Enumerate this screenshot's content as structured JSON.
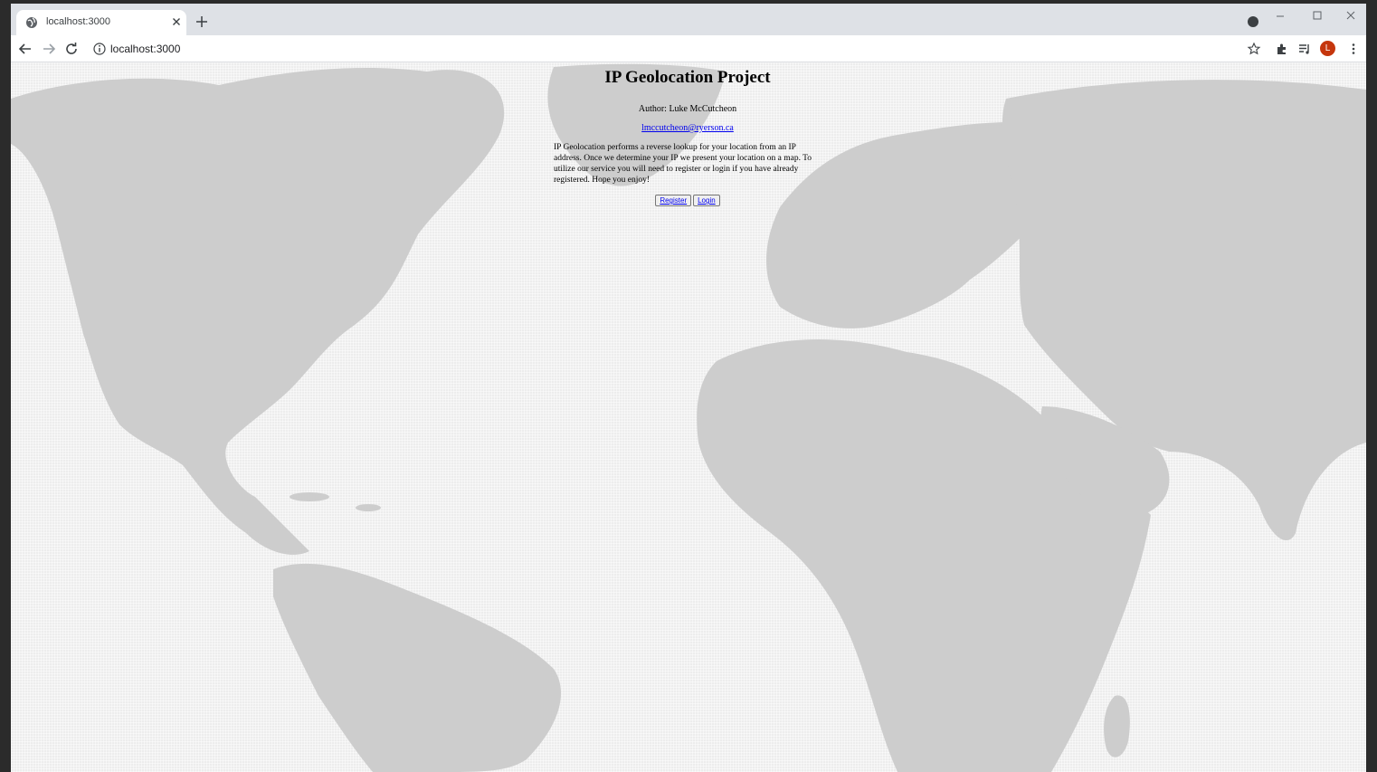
{
  "browser": {
    "tab_title": "localhost:3000",
    "address": "localhost:3000",
    "profile_initial": "L"
  },
  "page": {
    "title": "IP Geolocation Project",
    "author": "Author: Luke McCutcheon",
    "email": "lmccutcheon@ryerson.ca",
    "description": "IP Geolocation performs a reverse lookup for your location from an IP address. Once we determine your IP we present your location on a map. To utilize our service you will need to register or login if you have already registered. Hope you enjoy!",
    "register_label": "Register",
    "login_label": "Login"
  },
  "colors": {
    "map_land": "#cdcdcd",
    "map_sea": "#ededed",
    "link": "#0000ee"
  }
}
